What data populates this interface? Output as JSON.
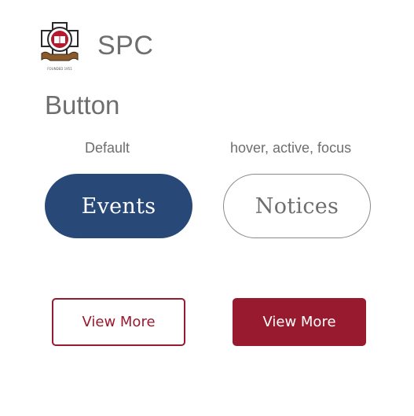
{
  "brand": {
    "name": "SPC",
    "logo_caption": "FOUNDED 1951"
  },
  "section": {
    "title": "Button"
  },
  "states": {
    "default_label": "Default",
    "hover_label": "hover, active, focus"
  },
  "pill_buttons": {
    "events_label": "Events",
    "notices_label": "Notices"
  },
  "view_more_buttons": {
    "outline_label": "View More",
    "filled_label": "View More"
  },
  "colors": {
    "primary_blue": "#284978",
    "brand_red": "#971a2e",
    "text_gray": "#6e6e6e"
  }
}
